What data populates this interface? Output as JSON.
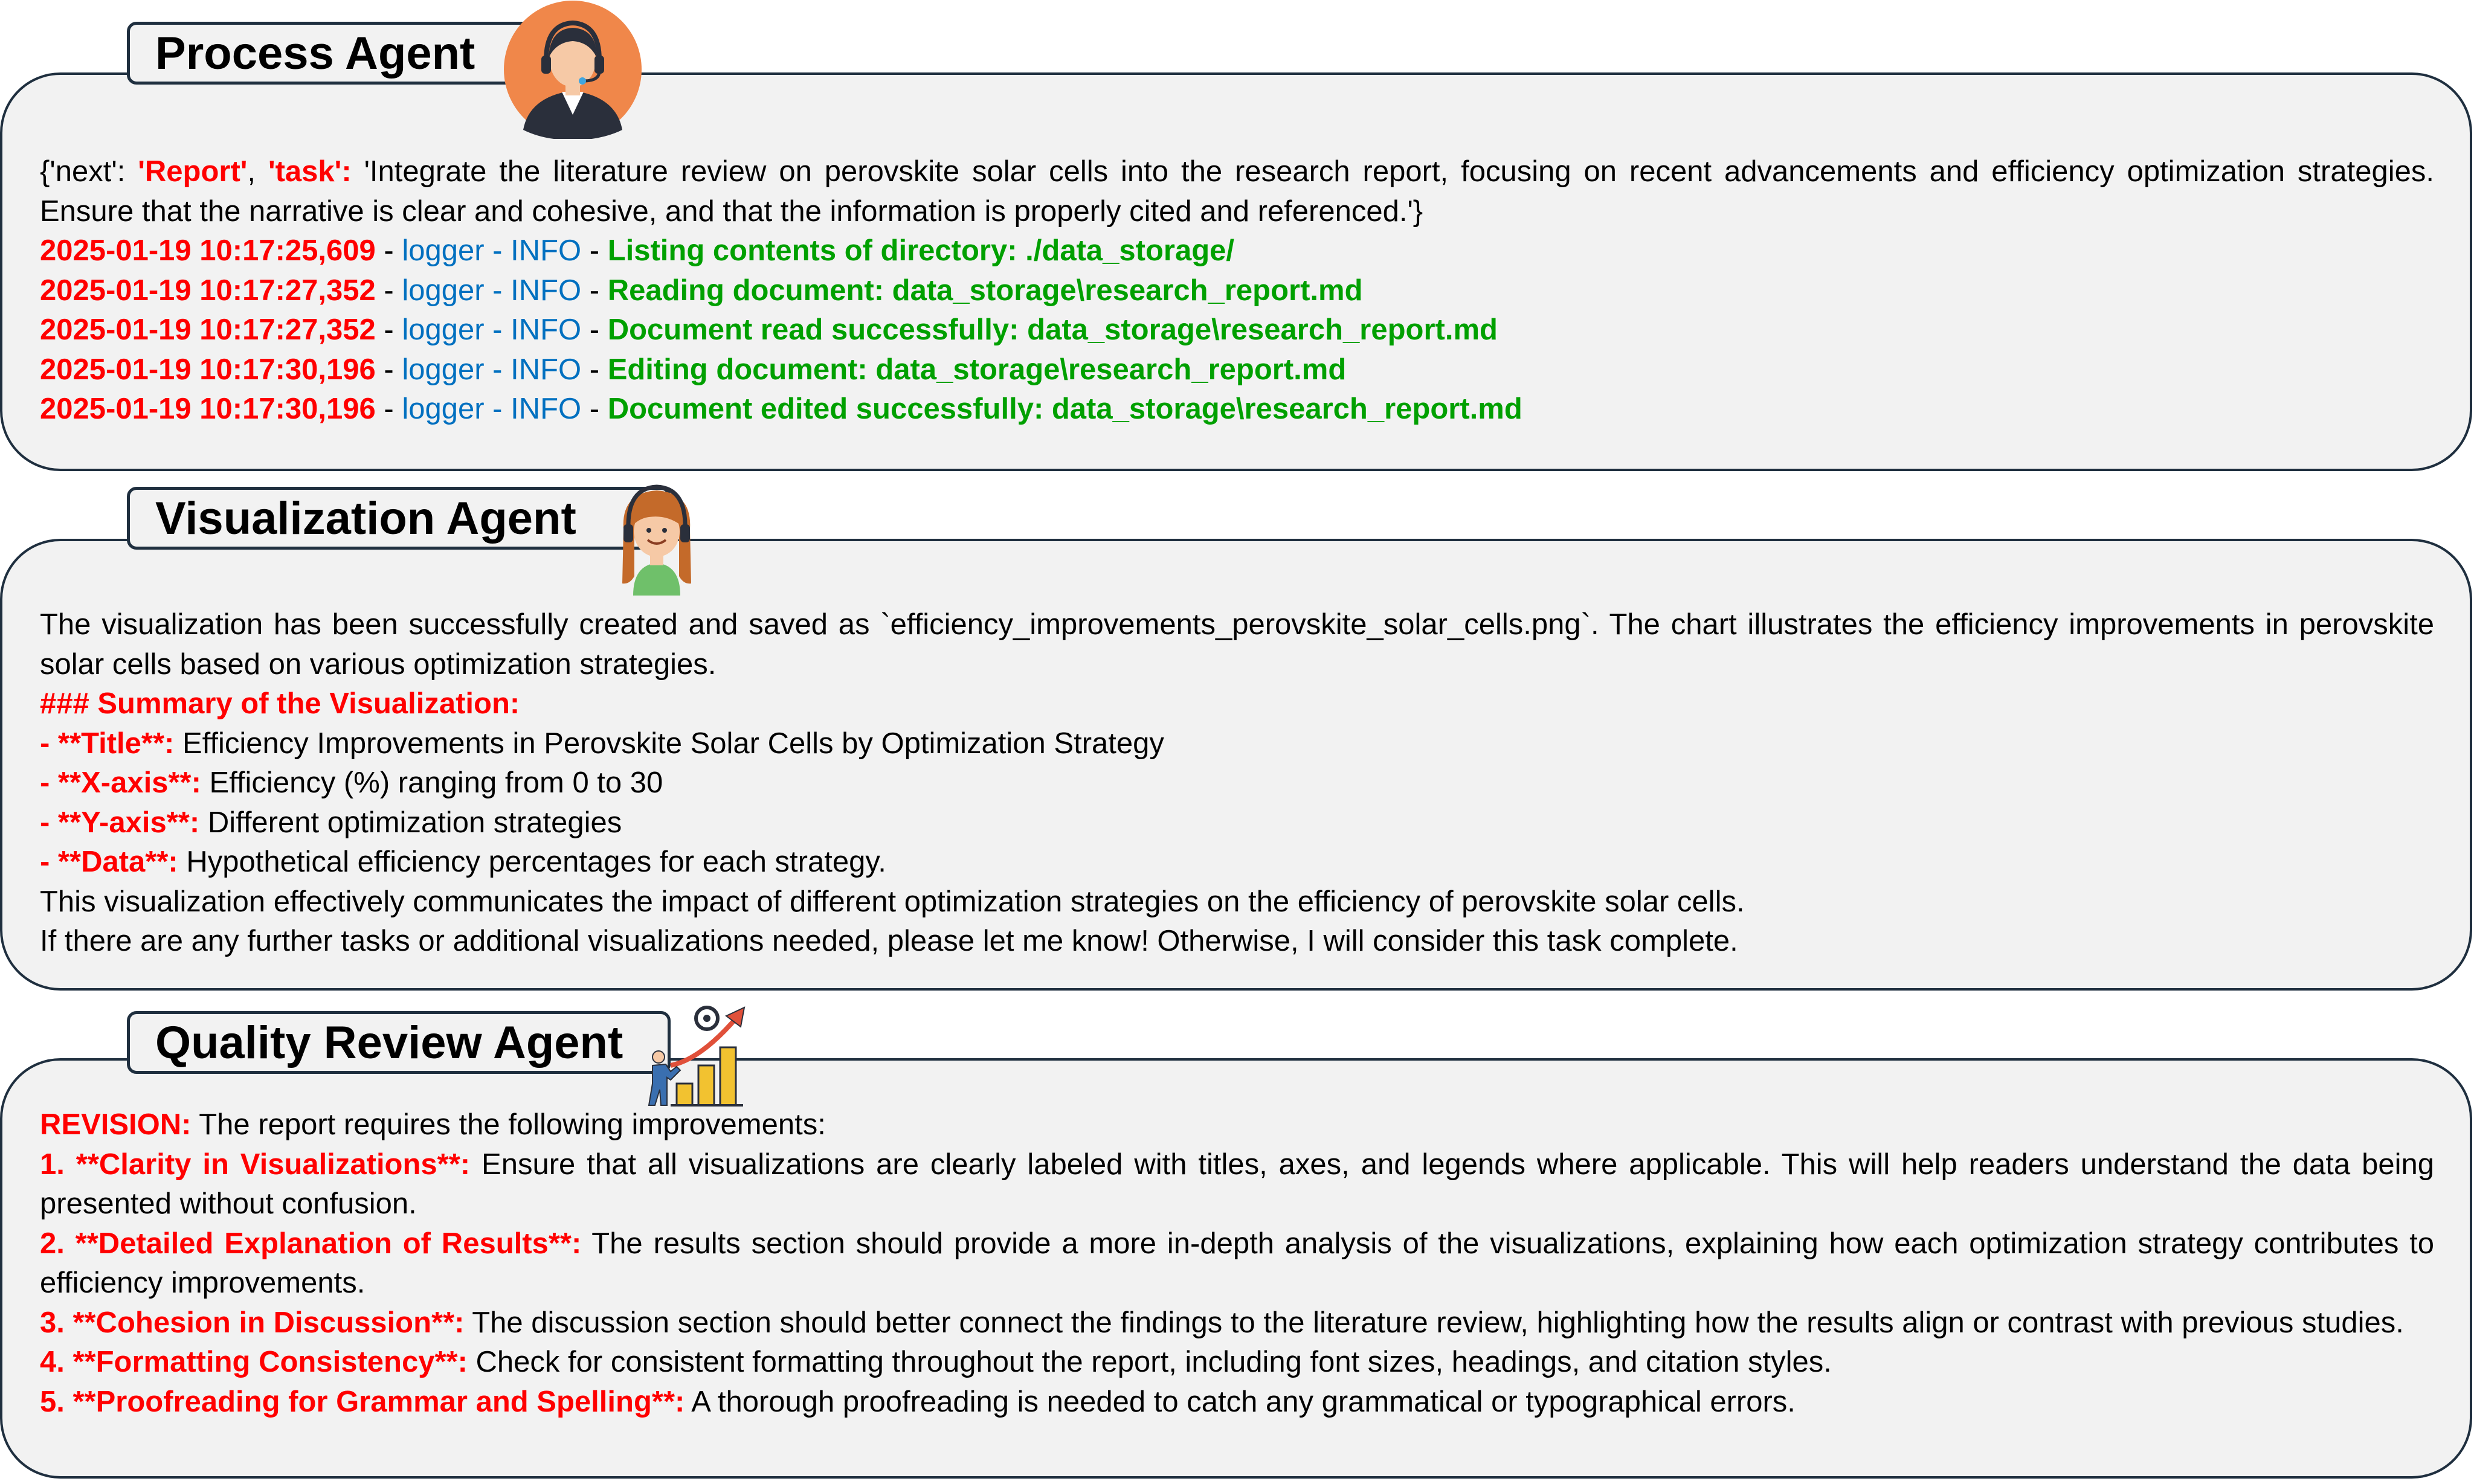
{
  "process_agent": {
    "title": "Process Agent",
    "task_json": {
      "open": "{'next': ",
      "next_value": "'Report'",
      "comma": ", ",
      "task_key": "'task':",
      "task_text": " 'Integrate the literature review on perovskite solar cells into the research report, focusing on recent advancements and efficiency optimization strategies. Ensure that the narrative is clear and cohesive, and that the information is properly cited and referenced.'}"
    },
    "logs": [
      {
        "timestamp": "2025-01-19 10:17:25,609",
        "sep1": " - ",
        "logger": "logger - INFO",
        "sep2": " - ",
        "message": "Listing contents of directory: ./data_storage/"
      },
      {
        "timestamp": "2025-01-19 10:17:27,352",
        "sep1": " - ",
        "logger": "logger - INFO",
        "sep2": " - ",
        "message": "Reading document: data_storage\\research_report.md"
      },
      {
        "timestamp": "2025-01-19 10:17:27,352",
        "sep1": " - ",
        "logger": "logger - INFO",
        "sep2": " - ",
        "message": "Document read successfully: data_storage\\research_report.md"
      },
      {
        "timestamp": "2025-01-19 10:17:30,196",
        "sep1": " - ",
        "logger": "logger - INFO",
        "sep2": " - ",
        "message": "Editing document: data_storage\\research_report.md"
      },
      {
        "timestamp": "2025-01-19 10:17:30,196",
        "sep1": " - ",
        "logger": "logger - INFO",
        "sep2": " - ",
        "message": "Document edited successfully: data_storage\\research_report.md"
      }
    ]
  },
  "visualization_agent": {
    "title": "Visualization Agent",
    "intro": "The visualization has been successfully created and saved as `efficiency_improvements_perovskite_solar_cells.png`. The chart illustrates the efficiency improvements in perovskite solar cells based on various optimization strategies.",
    "summary_heading": "### Summary of the Visualization:",
    "items": [
      {
        "label": "- **Title**:",
        "text": " Efficiency Improvements in Perovskite Solar Cells by Optimization Strategy"
      },
      {
        "label": "- **X-axis**:",
        "text": " Efficiency (%) ranging from 0 to 30"
      },
      {
        "label": "- **Y-axis**:",
        "text": " Different optimization strategies"
      },
      {
        "label": "- **Data**:",
        "text": " Hypothetical efficiency percentages for each strategy."
      }
    ],
    "closing_1": "This visualization effectively communicates the impact of different optimization strategies on the efficiency of perovskite solar cells.",
    "closing_2": "If there are any further tasks or additional visualizations needed, please let me know! Otherwise, I will consider this task complete."
  },
  "quality_review_agent": {
    "title": "Quality Review Agent",
    "revision_label": "REVISION:",
    "revision_text": " The report requires the following improvements:",
    "items": [
      {
        "label": "1. **Clarity in Visualizations**:",
        "text": " Ensure that all visualizations are clearly labeled with titles, axes, and legends where applicable. This will help readers understand the data being presented without confusion."
      },
      {
        "label": "2. **Detailed Explanation of Results**:",
        "text": " The results section should provide a more in-depth analysis of the visualizations, explaining how each optimization strategy contributes to efficiency improvements."
      },
      {
        "label": "3. **Cohesion in Discussion**:",
        "text": " The discussion section should better connect the findings to the literature review, highlighting how the results align or contrast with previous studies."
      },
      {
        "label": "4. **Formatting Consistency**:",
        "text": " Check for consistent formatting throughout the report, including font sizes, headings, and citation styles."
      },
      {
        "label": "5. **Proofreading for Grammar and Spelling**:",
        "text": " A thorough proofreading is needed to catch any grammatical or typographical errors."
      }
    ]
  },
  "icons": {
    "process": "headset-operator-icon",
    "visualization": "support-woman-icon",
    "quality": "growth-chart-icon"
  },
  "colors": {
    "timestamp": "#ff0000",
    "logger": "#0070c0",
    "message": "#00a000",
    "panel_bg": "#f2f2f2",
    "border": "#1f2f3f",
    "avatar_bg": "#f0874a"
  }
}
